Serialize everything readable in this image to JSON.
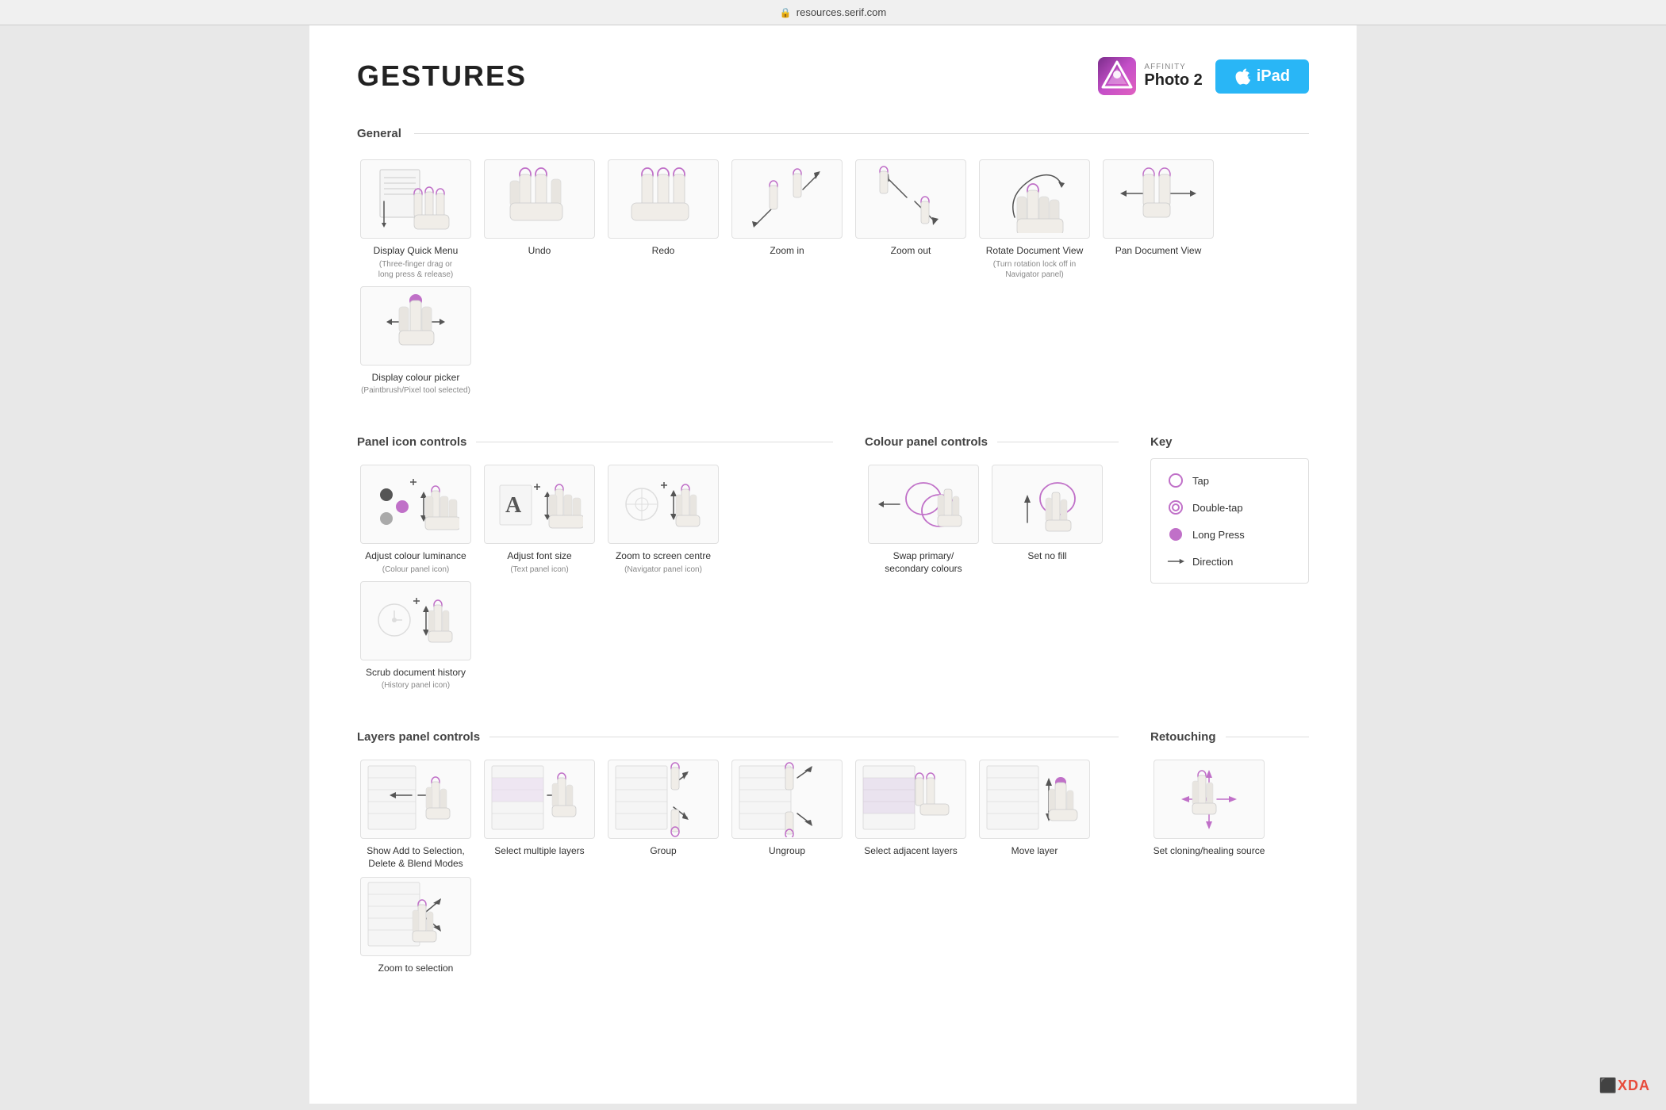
{
  "browser": {
    "url": "resources.serif.com"
  },
  "header": {
    "title": "GESTURES",
    "affinity_label": "AFFINITY",
    "product_label": "Photo 2",
    "ipad_label": "iPad"
  },
  "sections": {
    "general": {
      "title": "General",
      "gestures": [
        {
          "id": "display-quick-menu",
          "label": "Display Quick Menu",
          "sublabel": "(Three-finger drag or long press & release)"
        },
        {
          "id": "undo",
          "label": "Undo",
          "sublabel": ""
        },
        {
          "id": "redo",
          "label": "Redo",
          "sublabel": ""
        },
        {
          "id": "zoom-in",
          "label": "Zoom in",
          "sublabel": ""
        },
        {
          "id": "zoom-out",
          "label": "Zoom out",
          "sublabel": ""
        },
        {
          "id": "rotate-doc",
          "label": "Rotate Document View",
          "sublabel": "(Turn rotation lock off in Navigator panel)"
        },
        {
          "id": "pan-doc",
          "label": "Pan Document View",
          "sublabel": ""
        },
        {
          "id": "colour-picker",
          "label": "Display colour picker",
          "sublabel": "(Paintbrush/Pixel tool selected)"
        }
      ]
    },
    "panel_icon": {
      "title": "Panel icon controls",
      "gestures": [
        {
          "id": "adj-luminance",
          "label": "Adjust colour luminance",
          "sublabel": "(Colour panel icon)"
        },
        {
          "id": "adj-font",
          "label": "Adjust font size",
          "sublabel": "(Text panel icon)"
        },
        {
          "id": "zoom-centre",
          "label": "Zoom to screen centre",
          "sublabel": "(Navigator panel icon)"
        },
        {
          "id": "scrub-history",
          "label": "Scrub document history",
          "sublabel": "(History panel icon)"
        }
      ]
    },
    "colour_panel": {
      "title": "Colour panel controls",
      "gestures": [
        {
          "id": "swap-colours",
          "label": "Swap primary/ secondary colours",
          "sublabel": ""
        },
        {
          "id": "set-no-fill",
          "label": "Set no fill",
          "sublabel": ""
        }
      ]
    },
    "key": {
      "title": "Key",
      "items": [
        {
          "id": "tap",
          "label": "Tap"
        },
        {
          "id": "double-tap",
          "label": "Double-tap"
        },
        {
          "id": "long-press",
          "label": "Long Press"
        },
        {
          "id": "direction",
          "label": "Direction"
        }
      ]
    },
    "layers": {
      "title": "Layers panel controls",
      "gestures": [
        {
          "id": "show-add",
          "label": "Show Add to Selection, Delete & Blend Modes",
          "sublabel": ""
        },
        {
          "id": "select-multiple",
          "label": "Select multiple layers",
          "sublabel": ""
        },
        {
          "id": "group",
          "label": "Group",
          "sublabel": ""
        },
        {
          "id": "ungroup",
          "label": "Ungroup",
          "sublabel": ""
        },
        {
          "id": "select-adjacent",
          "label": "Select adjacent layers",
          "sublabel": ""
        },
        {
          "id": "move-layer",
          "label": "Move layer",
          "sublabel": ""
        },
        {
          "id": "zoom-selection",
          "label": "Zoom to selection",
          "sublabel": ""
        }
      ]
    },
    "retouching": {
      "title": "Retouching",
      "gestures": [
        {
          "id": "set-cloning",
          "label": "Set cloning/healing source",
          "sublabel": ""
        }
      ]
    }
  }
}
